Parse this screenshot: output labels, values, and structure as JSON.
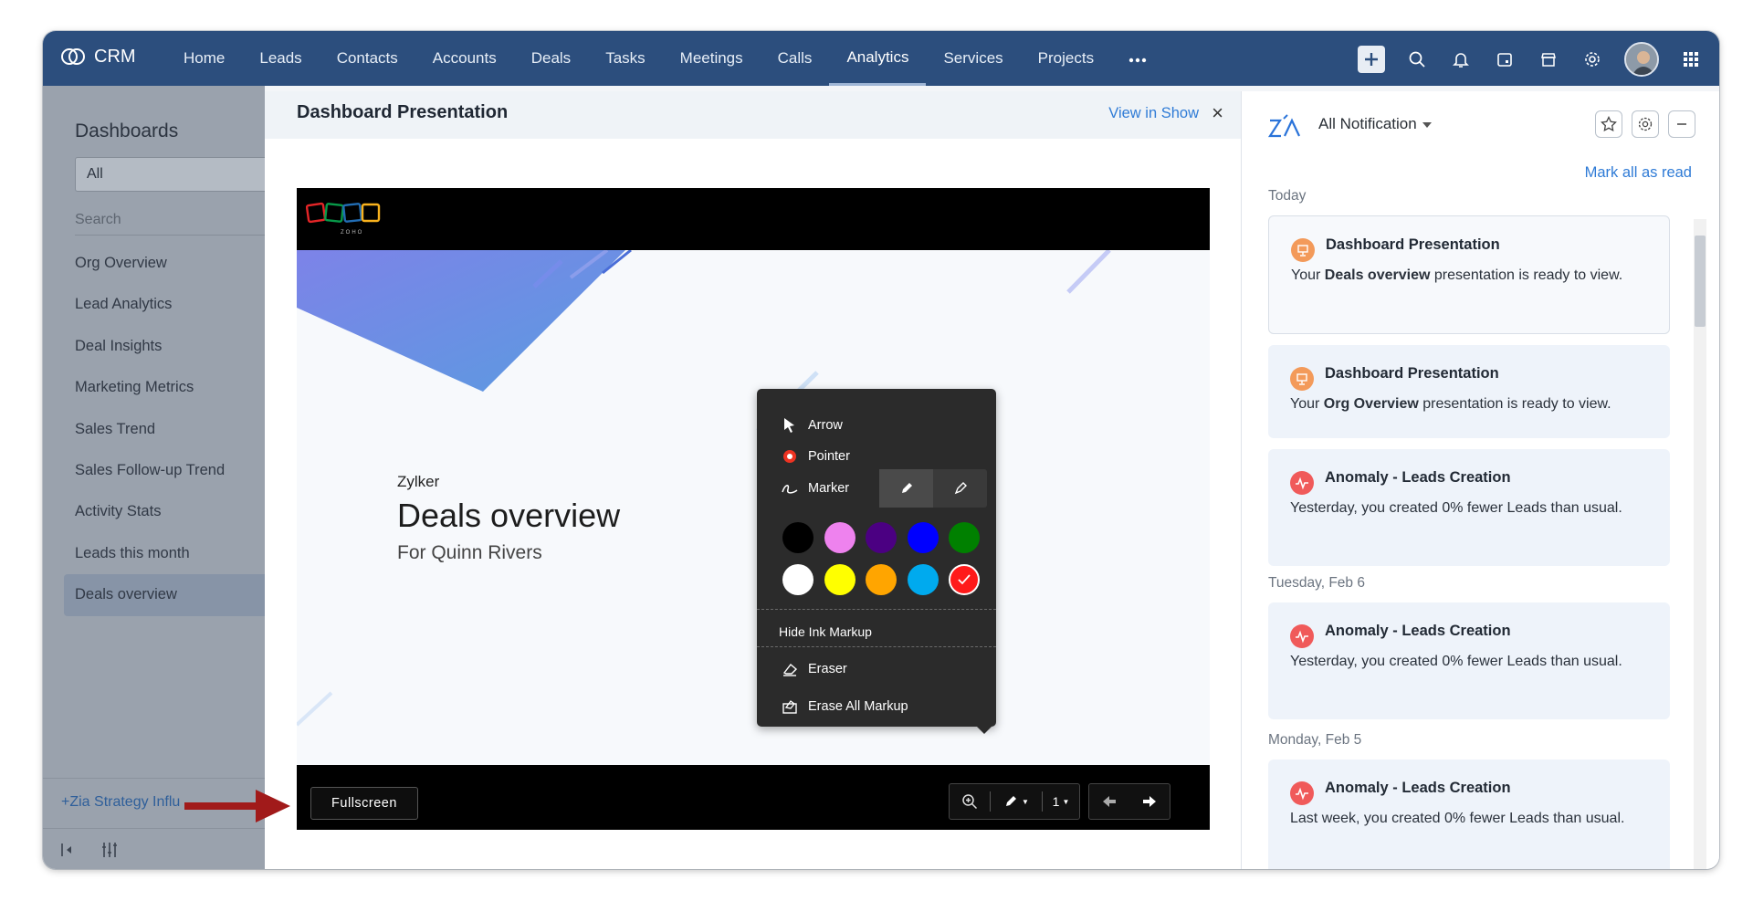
{
  "topbar": {
    "brand": "CRM",
    "nav": [
      "Home",
      "Leads",
      "Contacts",
      "Accounts",
      "Deals",
      "Tasks",
      "Meetings",
      "Calls",
      "Analytics",
      "Services",
      "Projects"
    ],
    "active": "Analytics",
    "more_icon": "more-dots-icon",
    "right_icons": [
      "plus-icon",
      "search-icon",
      "bell-icon",
      "calendar-icon",
      "store-icon",
      "gear-icon",
      "avatar",
      "apps-grid-icon"
    ]
  },
  "sidebar": {
    "title": "Dashboards",
    "select_value": "All",
    "search_placeholder": "Search",
    "items": [
      "Org Overview",
      "Lead Analytics",
      "Deal Insights",
      "Marketing Metrics",
      "Sales Trend",
      "Sales Follow-up Trend",
      "Activity Stats",
      "Leads this month",
      "Deals overview"
    ],
    "selected": "Deals overview",
    "footer_link": "+Zia Strategy Influ"
  },
  "modal": {
    "title": "Dashboard Presentation",
    "view_in_show": "View in Show",
    "close_label": "×",
    "slide": {
      "company": "Zylker",
      "title": "Deals overview",
      "subtitle": "For Quinn Rivers",
      "logo_text": "ZOHO"
    },
    "fullscreen_label": "Fullscreen",
    "page_number": "1"
  },
  "ink_menu": {
    "arrow_label": "Arrow",
    "pointer_label": "Pointer",
    "marker_label": "Marker",
    "colors": [
      "#000000",
      "#ee82ee",
      "#4b0082",
      "#0000ff",
      "#008000",
      "#ffffff",
      "#ffff00",
      "#ffa500",
      "#00aaee",
      "#ff1a1a"
    ],
    "selected_color": "#ff1a1a",
    "hide_label": "Hide Ink Markup",
    "eraser_label": "Eraser",
    "erase_all_label": "Erase All Markup"
  },
  "notifications": {
    "filter": "All Notification",
    "mark_all": "Mark all as read",
    "groups": [
      {
        "date": "Today",
        "cards": [
          {
            "type": "presentation",
            "title": "Dashboard Presentation",
            "pre": "Your ",
            "bold": "Deals overview",
            "post": " presentation is ready to view."
          },
          {
            "type": "presentation",
            "title": "Dashboard Presentation",
            "pre": "Your ",
            "bold": "Org Overview",
            "post": " presentation is ready to view."
          },
          {
            "type": "anomaly",
            "title": "Anomaly - Leads Creation",
            "pre": "Yesterday, you created 0% fewer Leads than usual.",
            "bold": "",
            "post": ""
          }
        ]
      },
      {
        "date": "Tuesday, Feb 6",
        "cards": [
          {
            "type": "anomaly",
            "title": "Anomaly - Leads Creation",
            "pre": "Yesterday, you created 0% fewer Leads than usual.",
            "bold": "",
            "post": ""
          }
        ]
      },
      {
        "date": "Monday, Feb 5",
        "cards": [
          {
            "type": "anomaly",
            "title": "Anomaly - Leads Creation",
            "pre": "Last week, you created 0% fewer Leads than usual.",
            "bold": "",
            "post": ""
          }
        ]
      }
    ],
    "colors": {
      "presentation": "#f39a5a",
      "anomaly": "#f05a5a"
    }
  }
}
